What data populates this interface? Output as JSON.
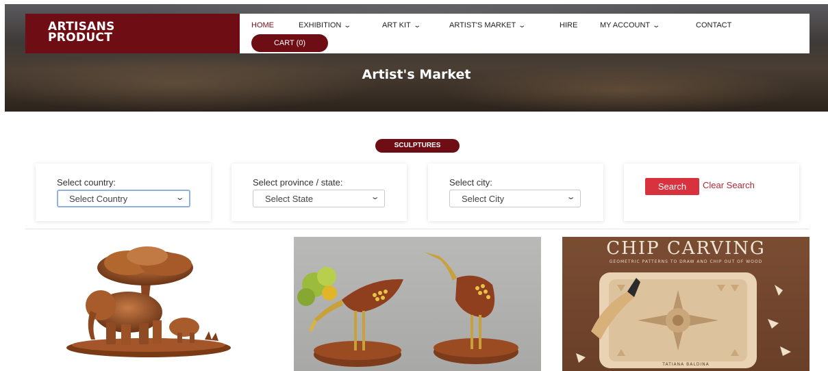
{
  "brand": {
    "line1": "ARTISANS",
    "line2": "PRODUCT",
    "color": "#6e0d14"
  },
  "nav": {
    "items": [
      {
        "label": "HOME",
        "dropdown": false,
        "active": true
      },
      {
        "label": "EXHIBITION",
        "dropdown": true
      },
      {
        "label": "ART KIT",
        "dropdown": true
      },
      {
        "label": "ARTIST'S MARKET",
        "dropdown": true
      },
      {
        "label": "HIRE",
        "dropdown": false
      },
      {
        "label": "MY ACCOUNT",
        "dropdown": true
      },
      {
        "label": "CONTACT",
        "dropdown": false
      }
    ],
    "cart_label": "CART (0)"
  },
  "hero": {
    "title": "Artist's Market"
  },
  "category_badge": "SCULPTURES",
  "filters": {
    "country": {
      "label": "Select country:",
      "value": "Select Country"
    },
    "state": {
      "label": "Select province / state:",
      "value": "Select State"
    },
    "city": {
      "label": "Select city:",
      "value": "Select City"
    },
    "search_label": "Search",
    "clear_label": "Clear Search"
  },
  "products": [
    {
      "icon": "elephant-tree-sculpture-image"
    },
    {
      "icon": "wooden-birds-sculpture-image"
    },
    {
      "icon": "chip-carving-book-cover-image",
      "title": "CHIP CARVING",
      "subtitle": "GEOMETRIC PATTERNS TO DRAW AND CHIP OUT OF WOOD",
      "author": "TATIANA BALDINA"
    }
  ],
  "colors": {
    "accent": "#6e0d14",
    "search_button": "#d9323f",
    "link": "#b02a36"
  }
}
